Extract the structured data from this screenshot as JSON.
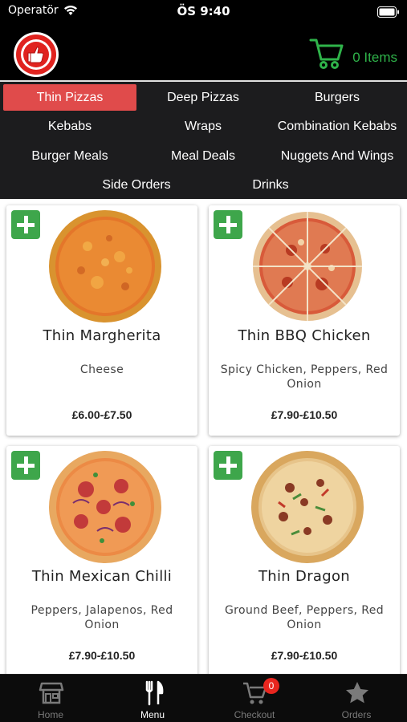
{
  "status_bar": {
    "carrier": "Operatör",
    "time": "ÖS 9:40"
  },
  "header": {
    "cart_count": "0 Items"
  },
  "categories": [
    {
      "label": "Thin Pizzas",
      "active": true
    },
    {
      "label": "Deep Pizzas"
    },
    {
      "label": "Burgers"
    },
    {
      "label": "Kebabs"
    },
    {
      "label": "Wraps"
    },
    {
      "label": "Combination Kebabs"
    },
    {
      "label": "Burger Meals"
    },
    {
      "label": "Meal Deals"
    },
    {
      "label": "Nuggets And Wings"
    },
    {
      "label": "Side Orders"
    },
    {
      "label": "Drinks"
    }
  ],
  "items": [
    {
      "name": "Thin Margherita",
      "description": "Cheese",
      "price": "£6.00-£7.50"
    },
    {
      "name": "Thin BBQ Chicken",
      "description": "Spicy Chicken, Peppers, Red Onion",
      "price": "£7.90-£10.50"
    },
    {
      "name": "Thin Mexican Chilli",
      "description": "Peppers, Jalapenos, Red Onion",
      "price": "£7.90-£10.50"
    },
    {
      "name": "Thin Dragon",
      "description": "Ground Beef, Peppers, Red Onion",
      "price": "£7.90-£10.50"
    }
  ],
  "tab_bar": {
    "home": "Home",
    "menu": "Menu",
    "checkout": "Checkout",
    "checkout_badge": "0",
    "orders": "Orders"
  },
  "colors": {
    "accent_red": "#e04b4b",
    "accent_green": "#3ea64b",
    "cart_green": "#2fb34a",
    "badge_red": "#e8261f"
  }
}
